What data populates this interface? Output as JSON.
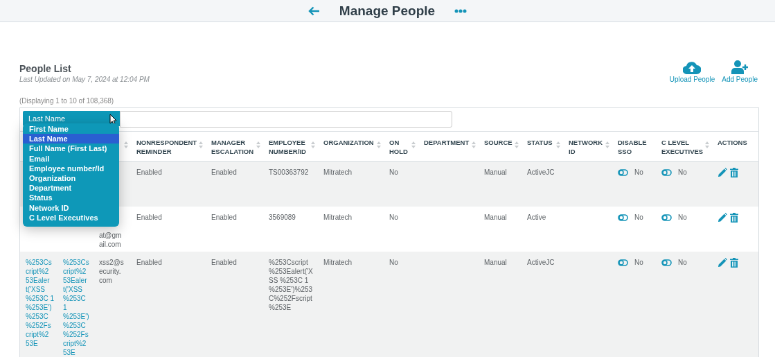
{
  "header": {
    "title": "Manage People"
  },
  "list": {
    "title": "People List",
    "updated": "Last Updated on May 7, 2024 at 12:04 PM",
    "displaying": "(Displaying 1 to 10 of 108,368)"
  },
  "actions": [
    {
      "kind": "upload",
      "label": "Upload People"
    },
    {
      "kind": "add",
      "label": "Add People"
    }
  ],
  "filter": {
    "field": "Last Name",
    "options": [
      {
        "label": "First Name",
        "selected": false
      },
      {
        "label": "Last Name",
        "selected": true
      },
      {
        "label": "Full Name (First Last)",
        "selected": false
      },
      {
        "label": "Email",
        "selected": false
      },
      {
        "label": "Employee number/Id",
        "selected": false
      },
      {
        "label": "Organization",
        "selected": false
      },
      {
        "label": "Department",
        "selected": false
      },
      {
        "label": "Status",
        "selected": false
      },
      {
        "label": "Network ID",
        "selected": false
      },
      {
        "label": "C Level Executives",
        "selected": false
      }
    ]
  },
  "table": {
    "columns": [
      {
        "kind": "link"
      },
      {
        "kind": "link"
      },
      {
        "kind": "text",
        "sortable": true
      },
      {
        "kind": "text",
        "label": "NONRESPONDENT REMINDER",
        "sortable": true
      },
      {
        "kind": "text",
        "label": "MANAGER ESCALATION",
        "sortable": true
      },
      {
        "kind": "text",
        "label": "EMPLOYEE NUMBER/ID",
        "sortable": true
      },
      {
        "kind": "text",
        "label": "ORGANIZATION",
        "sortable": true
      },
      {
        "kind": "text",
        "label": "ON HOLD",
        "sortable": true
      },
      {
        "kind": "text",
        "label": "DEPARTMENT",
        "sortable": true
      },
      {
        "kind": "text",
        "label": "SOURCE",
        "sortable": true
      },
      {
        "kind": "text",
        "label": "STATUS",
        "sortable": true
      },
      {
        "kind": "text",
        "label": "NETWORK ID",
        "sortable": true
      },
      {
        "kind": "toggle",
        "label": "DISABLE SSO"
      },
      {
        "kind": "toggle",
        "label": "C LEVEL EXECUTIVES",
        "sortable": true
      },
      {
        "kind": "actions",
        "label": "ACTIONS"
      }
    ],
    "rows": [
      {
        "cells": [
          {},
          {},
          {},
          {
            "text": "Enabled"
          },
          {
            "text": "Enabled"
          },
          {
            "text": "TS00363792"
          },
          {
            "text": "Mitratech"
          },
          {
            "text": "No"
          },
          {},
          {
            "text": "Manual"
          },
          {
            "text": "ActiveJC"
          },
          {},
          {
            "text": "No",
            "on": false
          },
          {
            "text": "No",
            "on": false
          },
          {}
        ]
      },
      {
        "cells": [
          {},
          {},
          {
            "text": "at@gm ail.com",
            "covered": true
          },
          {
            "text": "Enabled"
          },
          {
            "text": "Enabled"
          },
          {
            "text": "3569089"
          },
          {
            "text": "Mitratech"
          },
          {
            "text": "No"
          },
          {},
          {
            "text": "Manual"
          },
          {
            "text": "Active"
          },
          {},
          {
            "text": "No",
            "on": false
          },
          {
            "text": "No",
            "on": false
          },
          {}
        ]
      },
      {
        "cells": [
          {
            "text": "%253Cs cript%2 53Ealer t('XSS %253C 1 %253E') %253C %252Fs cript%2 53E"
          },
          {
            "text": "%253Cs cript%2 53Ealer t('XSS %253C 1 %253E') %253C %252Fs cript%2 53E"
          },
          {
            "text": "xss2@s ecurity. com"
          },
          {
            "text": "Enabled"
          },
          {
            "text": "Enabled"
          },
          {
            "text": "%253Cscript %253Ealert('X SS %253C 1 %253E')%253 C%252Fscript %253E"
          },
          {
            "text": "Mitratech"
          },
          {
            "text": "No"
          },
          {},
          {
            "text": "Manual"
          },
          {
            "text": "ActiveJC"
          },
          {},
          {
            "text": "No",
            "on": false
          },
          {
            "text": "No",
            "on": false
          },
          {}
        ]
      }
    ]
  }
}
